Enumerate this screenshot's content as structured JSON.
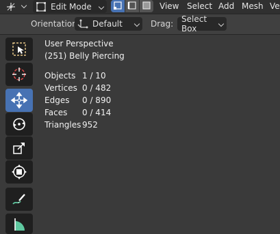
{
  "header": {
    "mode_label": "Edit Mode",
    "menus": [
      "View",
      "Select",
      "Add",
      "Mesh",
      "Ve"
    ]
  },
  "tool_header": {
    "orientation_label": "Orientation:",
    "orientation_value": "Default",
    "drag_label": "Drag:",
    "drag_value": "Select Box"
  },
  "overlay": {
    "perspective": "User Perspective",
    "object_name": "(251) Belly Piercing",
    "stats": [
      {
        "label": "Objects",
        "value": "1 / 10"
      },
      {
        "label": "Vertices",
        "value": "0 / 482"
      },
      {
        "label": "Edges",
        "value": "0 / 890"
      },
      {
        "label": "Faces",
        "value": "0 / 414"
      },
      {
        "label": "Triangles",
        "value": "952"
      }
    ]
  },
  "toolbar": {
    "tools": [
      {
        "icon": "select-box-icon",
        "active": false
      },
      {
        "icon": "cursor-icon",
        "active": false
      },
      {
        "icon": "move-icon",
        "active": true
      },
      {
        "icon": "rotate-icon",
        "active": false
      },
      {
        "icon": "scale-icon",
        "active": false
      },
      {
        "icon": "transform-icon",
        "active": false
      },
      {
        "icon": "annotate-icon",
        "active": false
      },
      {
        "icon": "measure-icon",
        "active": false
      }
    ]
  },
  "colors": {
    "accent": "#4772b3",
    "background": "#3a3a3a",
    "header": "#303030"
  }
}
